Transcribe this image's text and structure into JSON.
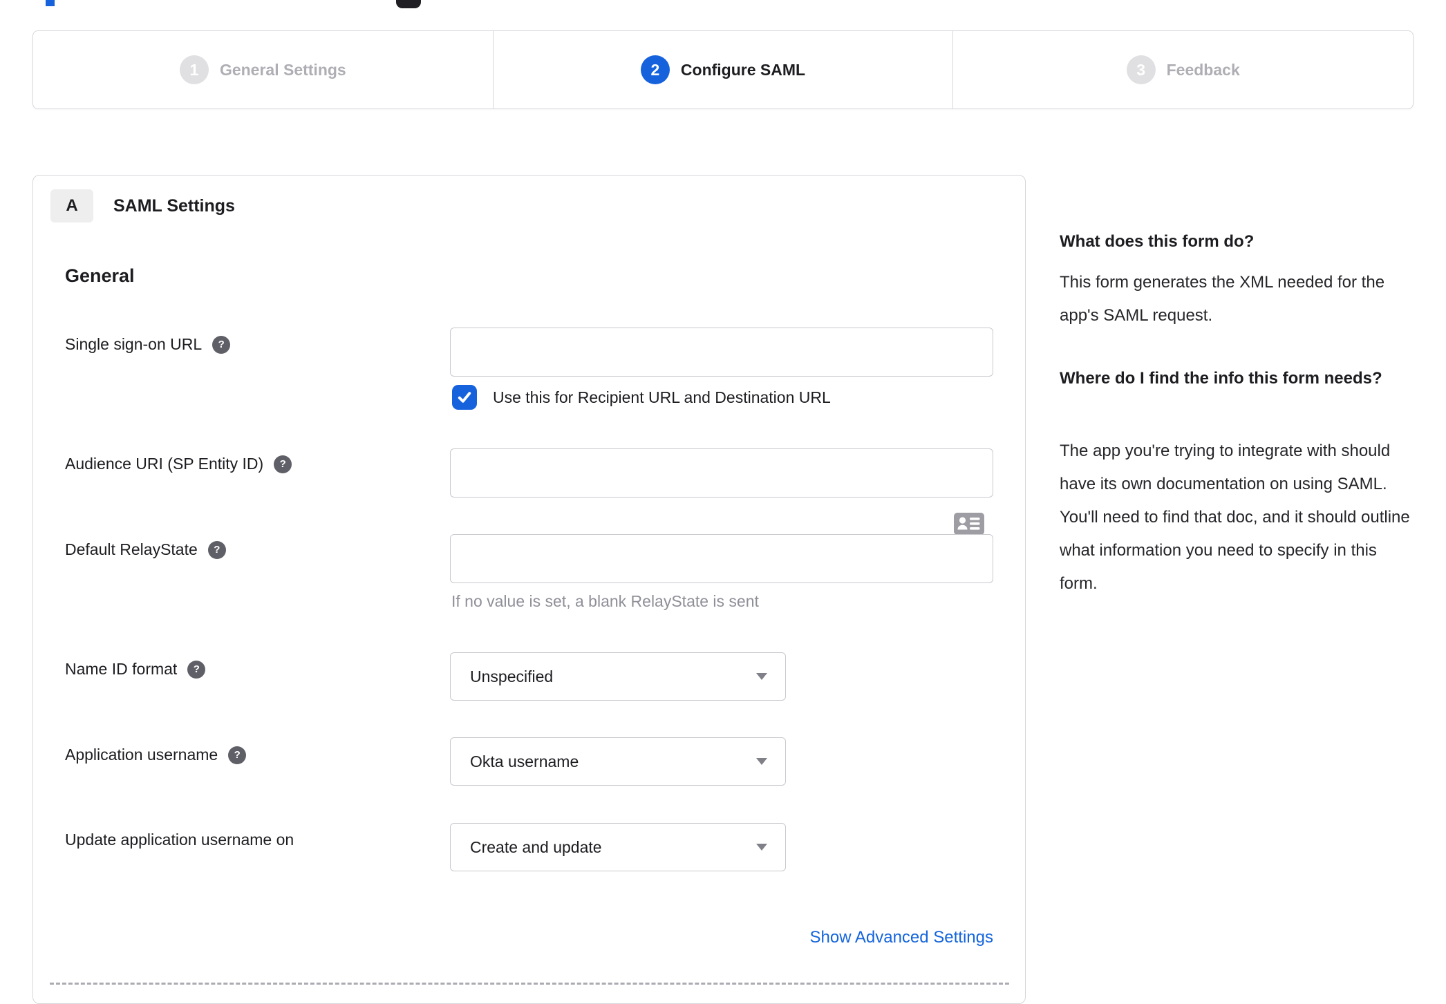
{
  "colors": {
    "accent_blue": "#1662dd",
    "inactive_step_gray": "#e0e0e3",
    "inactive_text_gray": "#aeaeb4",
    "text_dark": "#1d1d21",
    "input_border": "#c9c9ce",
    "helper_gray": "#8f8f98",
    "link_blue": "#1465dd"
  },
  "stepper": {
    "steps": [
      {
        "number": "1",
        "label": "General Settings",
        "state": "inactive"
      },
      {
        "number": "2",
        "label": "Configure SAML",
        "state": "active"
      },
      {
        "number": "3",
        "label": "Feedback",
        "state": "inactive"
      }
    ]
  },
  "saml_card": {
    "section_badge": "A",
    "section_title": "SAML Settings",
    "group_title": "General",
    "fields": {
      "sso_url": {
        "label": "Single sign-on URL",
        "value": "",
        "has_help": true,
        "trailing_icon": "contact-card",
        "checkbox_label": "Use this for Recipient URL and Destination URL",
        "checkbox_checked": true
      },
      "audience_uri": {
        "label": "Audience URI (SP Entity ID)",
        "value": "",
        "has_help": true
      },
      "default_relay_state": {
        "label": "Default RelayState",
        "value": "",
        "has_help": true,
        "helper": "If no value is set, a blank RelayState is sent"
      },
      "name_id_format": {
        "label": "Name ID format",
        "has_help": true,
        "value": "Unspecified"
      },
      "application_username": {
        "label": "Application username",
        "has_help": true,
        "value": "Okta username"
      },
      "update_app_username_on": {
        "label": "Update application username on",
        "has_help": false,
        "value": "Create and update"
      }
    },
    "advanced_link": "Show Advanced Settings"
  },
  "help_panel": {
    "sections": [
      {
        "heading": "What does this form do?",
        "body": "This form generates the XML needed for the app's SAML request."
      },
      {
        "heading": "Where do I find the info this form needs?",
        "body": "The app you're trying to integrate with should have its own documentation on using SAML. You'll need to find that doc, and it should outline what information you need to specify in this form."
      }
    ]
  }
}
